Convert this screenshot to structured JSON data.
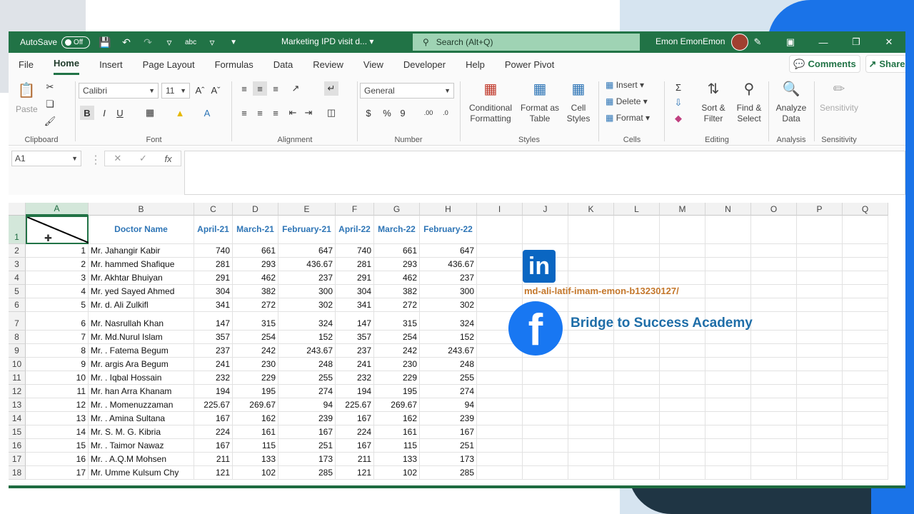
{
  "titlebar": {
    "autosave_label": "AutoSave",
    "toggle_label": "Off",
    "doc_title": "Marketing IPD visit d...",
    "search_placeholder": "Search (Alt+Q)",
    "user_name": "Emon EmonEmon"
  },
  "menu": {
    "items": [
      "File",
      "Home",
      "Insert",
      "Page Layout",
      "Formulas",
      "Data",
      "Review",
      "View",
      "Developer",
      "Help",
      "Power Pivot"
    ],
    "active": "Home",
    "comments_label": "Comments",
    "share_label": "Share"
  },
  "ribbon": {
    "clipboard": {
      "paste": "Paste",
      "label": "Clipboard"
    },
    "font": {
      "name": "Calibri",
      "size": "11",
      "label": "Font"
    },
    "alignment": {
      "label": "Alignment"
    },
    "number": {
      "format": "General",
      "label": "Number"
    },
    "styles": {
      "conditional": "Conditional",
      "conditional2": "Formatting",
      "format_as": "Format as",
      "format_as2": "Table",
      "cell": "Cell",
      "cell2": "Styles",
      "label": "Styles"
    },
    "cells": {
      "insert": "Insert",
      "delete": "Delete",
      "format": "Format",
      "label": "Cells"
    },
    "editing": {
      "sort": "Sort &",
      "sort2": "Filter",
      "find": "Find &",
      "find2": "Select",
      "label": "Editing"
    },
    "analysis": {
      "analyze": "Analyze",
      "analyze2": "Data",
      "label": "Analysis"
    },
    "sensitivity": {
      "btn": "Sensitivity",
      "label": "Sensitivity"
    }
  },
  "formula_bar": {
    "name_box": "A1",
    "content": ""
  },
  "columns": [
    "A",
    "B",
    "C",
    "D",
    "E",
    "F",
    "G",
    "H",
    "I",
    "J",
    "K",
    "L",
    "M",
    "N",
    "O",
    "P",
    "Q"
  ],
  "header_row": [
    "",
    "Doctor Name",
    "April-21",
    "March-21",
    "February-21",
    "April-22",
    "March-22",
    "February-22"
  ],
  "rows": [
    {
      "num": "2",
      "cells": [
        "1",
        "Mr. Jahangir  Kabir",
        "740",
        "661",
        "647",
        "740",
        "661",
        "647"
      ]
    },
    {
      "num": "3",
      "cells": [
        "2",
        "Mr. hammed Shafique",
        "281",
        "293",
        "436.67",
        "281",
        "293",
        "436.67"
      ]
    },
    {
      "num": "4",
      "cells": [
        "3",
        "Mr.  Akhtar Bhuiyan",
        "291",
        "462",
        "237",
        "291",
        "462",
        "237"
      ]
    },
    {
      "num": "5",
      "cells": [
        "4",
        "Mr. yed Sayed Ahmed",
        "304",
        "382",
        "300",
        "304",
        "382",
        "300"
      ]
    },
    {
      "num": "6",
      "cells": [
        "5",
        "Mr. d. Ali  Zulkifl",
        "341",
        "272",
        "302",
        "341",
        "272",
        "302"
      ]
    },
    {
      "num": "7",
      "cells": [
        "6",
        "Mr.  Nasrullah Khan",
        "147",
        "315",
        "324",
        "147",
        "315",
        "324"
      ]
    },
    {
      "num": "8",
      "cells": [
        "7",
        "Mr. Md.Nurul  Islam",
        "357",
        "254",
        "152",
        "357",
        "254",
        "152"
      ]
    },
    {
      "num": "9",
      "cells": [
        "8",
        "Mr. . Fatema  Begum",
        "237",
        "242",
        "243.67",
        "237",
        "242",
        "243.67"
      ]
    },
    {
      "num": "10",
      "cells": [
        "9",
        "Mr. argis Ara Begum",
        "241",
        "230",
        "248",
        "241",
        "230",
        "248"
      ]
    },
    {
      "num": "11",
      "cells": [
        "10",
        "Mr. . Iqbal Hossain",
        "232",
        "229",
        "255",
        "232",
        "229",
        "255"
      ]
    },
    {
      "num": "12",
      "cells": [
        "11",
        "Mr. han Arra Khanam",
        "194",
        "195",
        "274",
        "194",
        "195",
        "274"
      ]
    },
    {
      "num": "13",
      "cells": [
        "12",
        "Mr. .  Momenuzzaman",
        "225.67",
        "269.67",
        "94",
        "225.67",
        "269.67",
        "94"
      ]
    },
    {
      "num": "14",
      "cells": [
        "13",
        "Mr. . Amina Sultana",
        "167",
        "162",
        "239",
        "167",
        "162",
        "239"
      ]
    },
    {
      "num": "15",
      "cells": [
        "14",
        "Mr. S. M. G. Kibria",
        "224",
        "161",
        "167",
        "224",
        "161",
        "167"
      ]
    },
    {
      "num": "16",
      "cells": [
        "15",
        "Mr. . Taimor  Nawaz",
        "167",
        "115",
        "251",
        "167",
        "115",
        "251"
      ]
    },
    {
      "num": "17",
      "cells": [
        "16",
        "Mr. . A.Q.M  Mohsen",
        "211",
        "133",
        "173",
        "211",
        "133",
        "173"
      ]
    },
    {
      "num": "18",
      "cells": [
        "17",
        "Mr. Umme Kulsum Chy",
        "121",
        "102",
        "285",
        "121",
        "102",
        "285"
      ]
    }
  ],
  "overlay": {
    "linkedin_url": "md-ali-latif-imam-emon-b13230127/",
    "facebook_text": "Bridge to Success Academy"
  },
  "colors": {
    "excel_green": "#217346",
    "header_blue": "#2e75b6",
    "linkedin": "#0a66c2",
    "facebook": "#1877f2"
  }
}
